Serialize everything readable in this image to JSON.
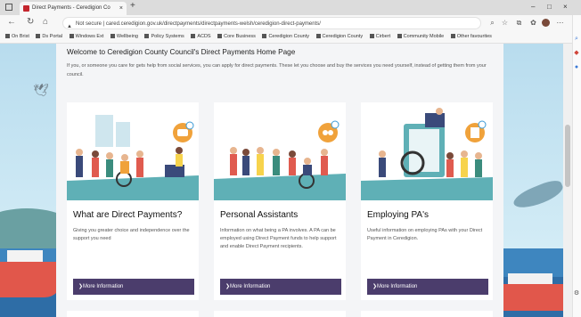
{
  "browser": {
    "tab_title": "Direct Payments - Ceredigion Co",
    "tab_close": "×",
    "new_tab": "+",
    "address": "Not secure | cared.ceredigion.gov.uk/directpayments/directpayments-welsh/ceredigion-direct-payments/",
    "bookmarks": [
      "On Brist",
      "Ds Portal",
      "Windows Ext",
      "Wellbeing",
      "Policy Systems",
      "ACDS",
      "Core Business",
      "Ceredigion County",
      "Ceredigion County",
      "Cirbert",
      "Community Mobile",
      "Other favourites"
    ],
    "window_controls": [
      "–",
      "□",
      "×"
    ]
  },
  "page": {
    "title": "Welcome to Ceredigion County Council's Direct Payments Home Page",
    "intro": "If you, or someone you care for gets help from social services, you can apply for direct payments. These let you choose and buy the services you need yourself, instead of getting them from your council."
  },
  "cards": [
    {
      "title": "What are Direct Payments?",
      "desc": "Giving you greater choice and independence over the support you need",
      "button": "More Information"
    },
    {
      "title": "Personal Assistants",
      "desc": "Information on what being a PA involves. A PA can be employed using Direct Payment funds to help support and enable Direct Payment recipients.",
      "button": "More Information"
    },
    {
      "title": "Employing PA's",
      "desc": "Useful information on employing PAs with your Direct Payment in Ceredigion.",
      "button": "More Information"
    }
  ],
  "icons": {
    "bird": "bird-icon",
    "arrow": "❯"
  },
  "colors": {
    "button": "#4b3d6c",
    "illustration_teal": "#5fb0b6",
    "badge_orange": "#f0a23b"
  }
}
